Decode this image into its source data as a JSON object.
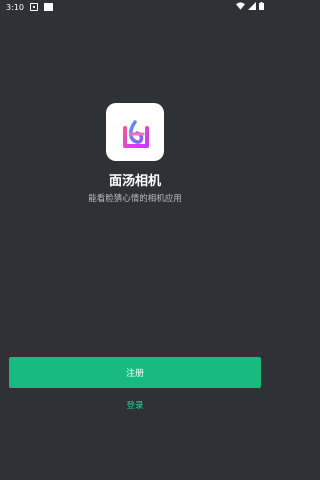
{
  "status_bar": {
    "time": "3:10",
    "icons": [
      "notification-icon",
      "app-indicator-icon",
      "wifi-icon",
      "signal-icon",
      "battery-icon"
    ]
  },
  "app": {
    "name": "面汤相机",
    "tagline": "能看脸猜心情的相机应用",
    "icon": "app-logo-icon"
  },
  "actions": {
    "register_label": "注册",
    "login_label": "登录"
  },
  "colors": {
    "background": "#2f3136",
    "accent": "#17bb7f",
    "link": "#2fcf8e"
  }
}
